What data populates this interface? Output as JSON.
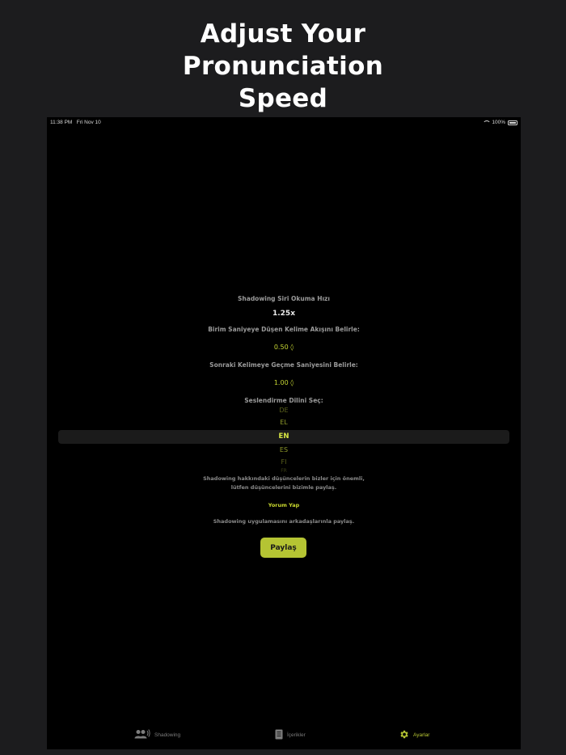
{
  "headline": {
    "line1": "Adjust Your",
    "line2": "Pronunciation",
    "line3": "Speed"
  },
  "status_bar": {
    "time": "11:38 PM",
    "date": "Fri Nov 10",
    "battery": "100%"
  },
  "settings": {
    "speed_label": "Shadowing Siri Okuma Hızı",
    "speed_value": "1.25x",
    "word_flow_label": "Birim Saniyeye Düşen Kelime Akışını Belirle:",
    "word_flow_value": "0.50 ◊",
    "next_word_label": "Sonraki Kelimeye Geçme Saniyesini Belirle:",
    "next_word_value": "1.00 ◊",
    "language_label": "Seslendirme Dilini Seç:",
    "language_options": [
      "DE",
      "EL",
      "EN",
      "ES",
      "FI",
      "FR"
    ],
    "language_selected": "EN"
  },
  "feedback": {
    "line1": "Shadowing hakkındaki düşüncelerin bizler için önemli,",
    "line2": "lütfen düşüncelerini bizimle paylaş.",
    "review_link": "Yorum Yap",
    "share_text": "Shadowing uygulamasını arkadaşlarınla paylaş.",
    "share_button": "Paylaş"
  },
  "tabs": [
    {
      "label": "Shadowing",
      "icon": "people-speaking-icon",
      "active": false
    },
    {
      "label": "İçerikler",
      "icon": "document-icon",
      "active": false
    },
    {
      "label": "Ayarlar",
      "icon": "gear-icon",
      "active": true
    }
  ],
  "colors": {
    "accent": "#b5c433",
    "background": "#000000",
    "frame": "#1c1c1e"
  }
}
